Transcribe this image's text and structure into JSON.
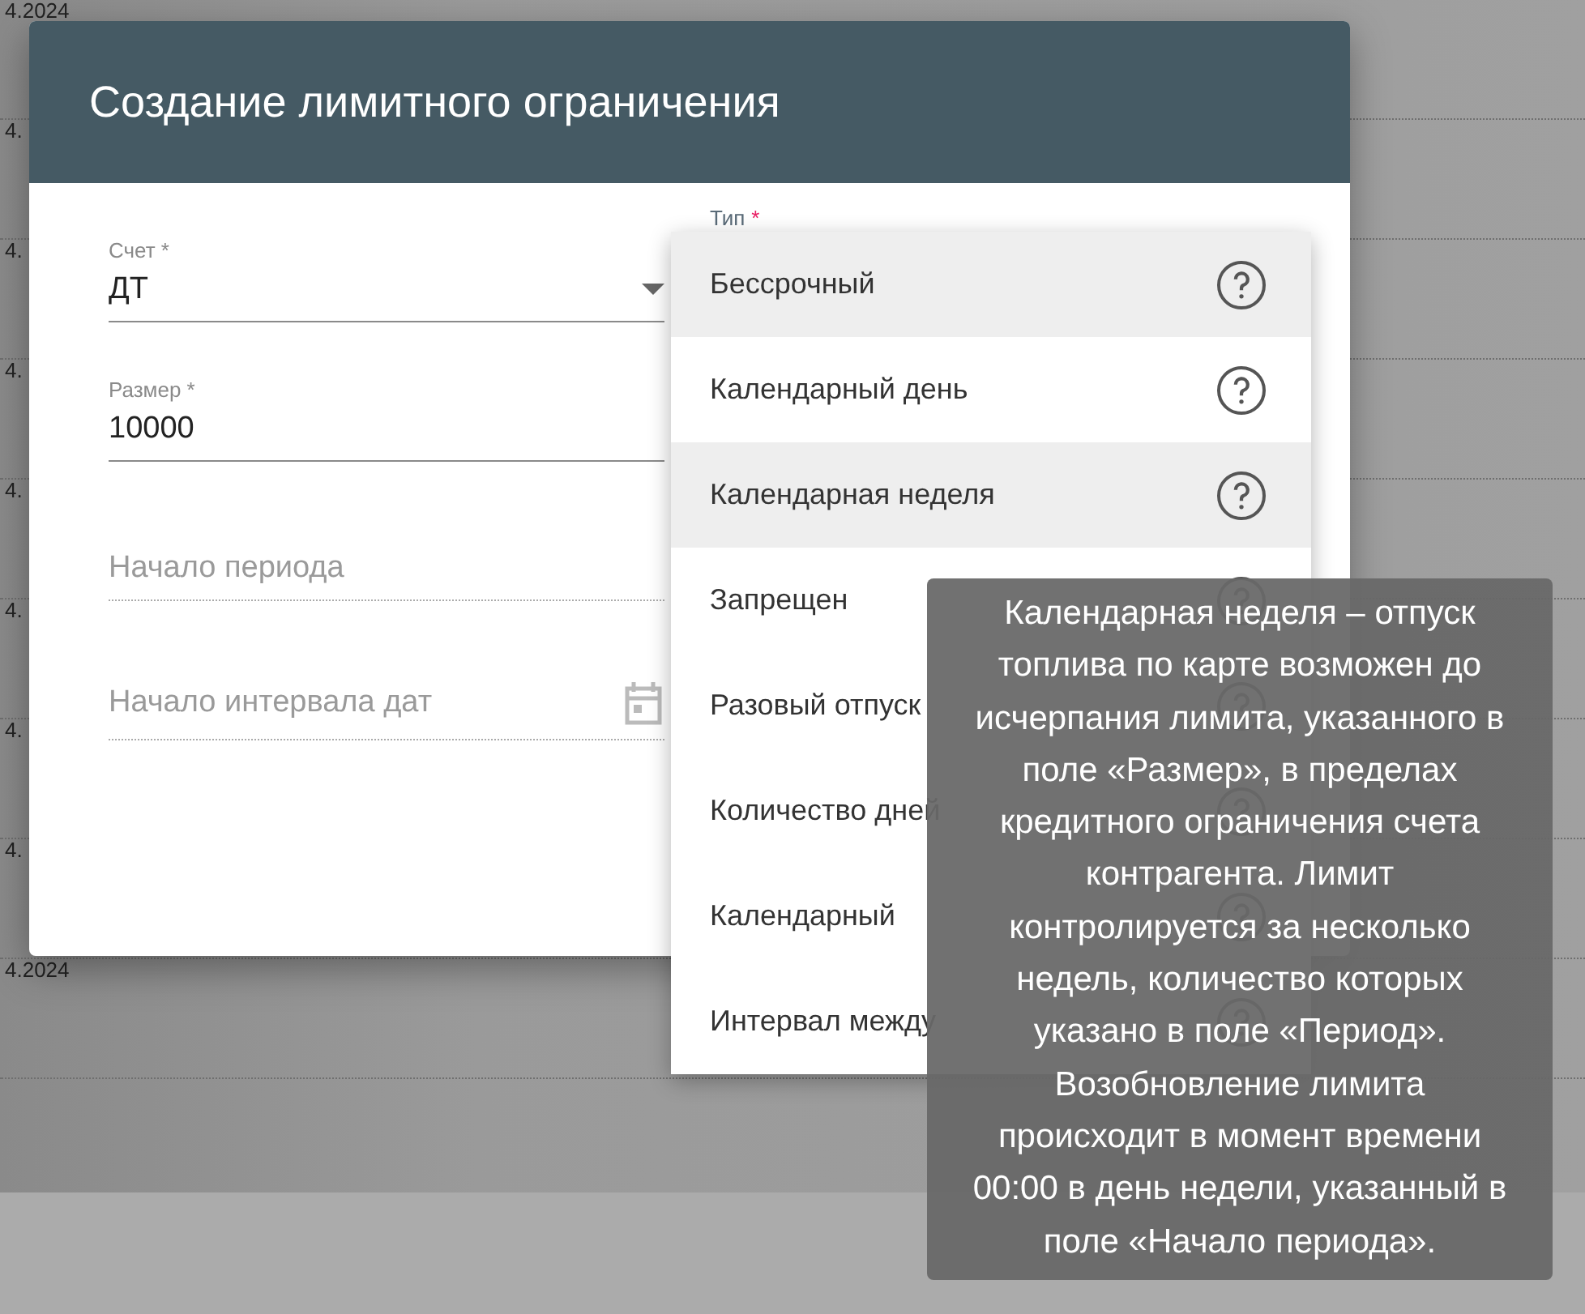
{
  "background_rows": [
    "4.2024",
    "4.",
    "4.",
    "4.",
    "4.",
    "4.",
    "4.",
    "4.",
    "4.2024"
  ],
  "dialog": {
    "title": "Создание лимитного ограничения",
    "fields": [
      {
        "kind": "select",
        "label": "Счет *",
        "value": "ДТ"
      },
      {
        "kind": "text",
        "label": "Размер *",
        "value": "10000"
      },
      {
        "kind": "date",
        "placeholder": "Начало периода"
      },
      {
        "kind": "date-icon",
        "placeholder": "Начало интервала дат"
      }
    ],
    "type_field": {
      "label": "Тип",
      "required_mark": "*"
    }
  },
  "menu": {
    "items": [
      {
        "label": "Бессрочный",
        "selected": true
      },
      {
        "label": "Календарный день",
        "selected": false
      },
      {
        "label": "Календарная неделя",
        "selected": true
      },
      {
        "label": "Запрещен",
        "selected": false
      },
      {
        "label": "Разовый отпуск",
        "selected": false
      },
      {
        "label": "Количество дней",
        "selected": false
      },
      {
        "label": "Календарный",
        "selected": false
      },
      {
        "label": "Интервал между",
        "selected": false
      }
    ]
  },
  "tooltip": {
    "text": "Календарная неделя – отпуск топлива по карте возможен до исчерпания лимита, указанного в поле «Размер», в пределах кредитного ограничения счета контрагента. Лимит контролируется за несколько недель, количество которых указано в поле «Период». Возобновление лимита происходит в момент времени 00:00 в день недели, указанный в поле «Начало периода»."
  }
}
